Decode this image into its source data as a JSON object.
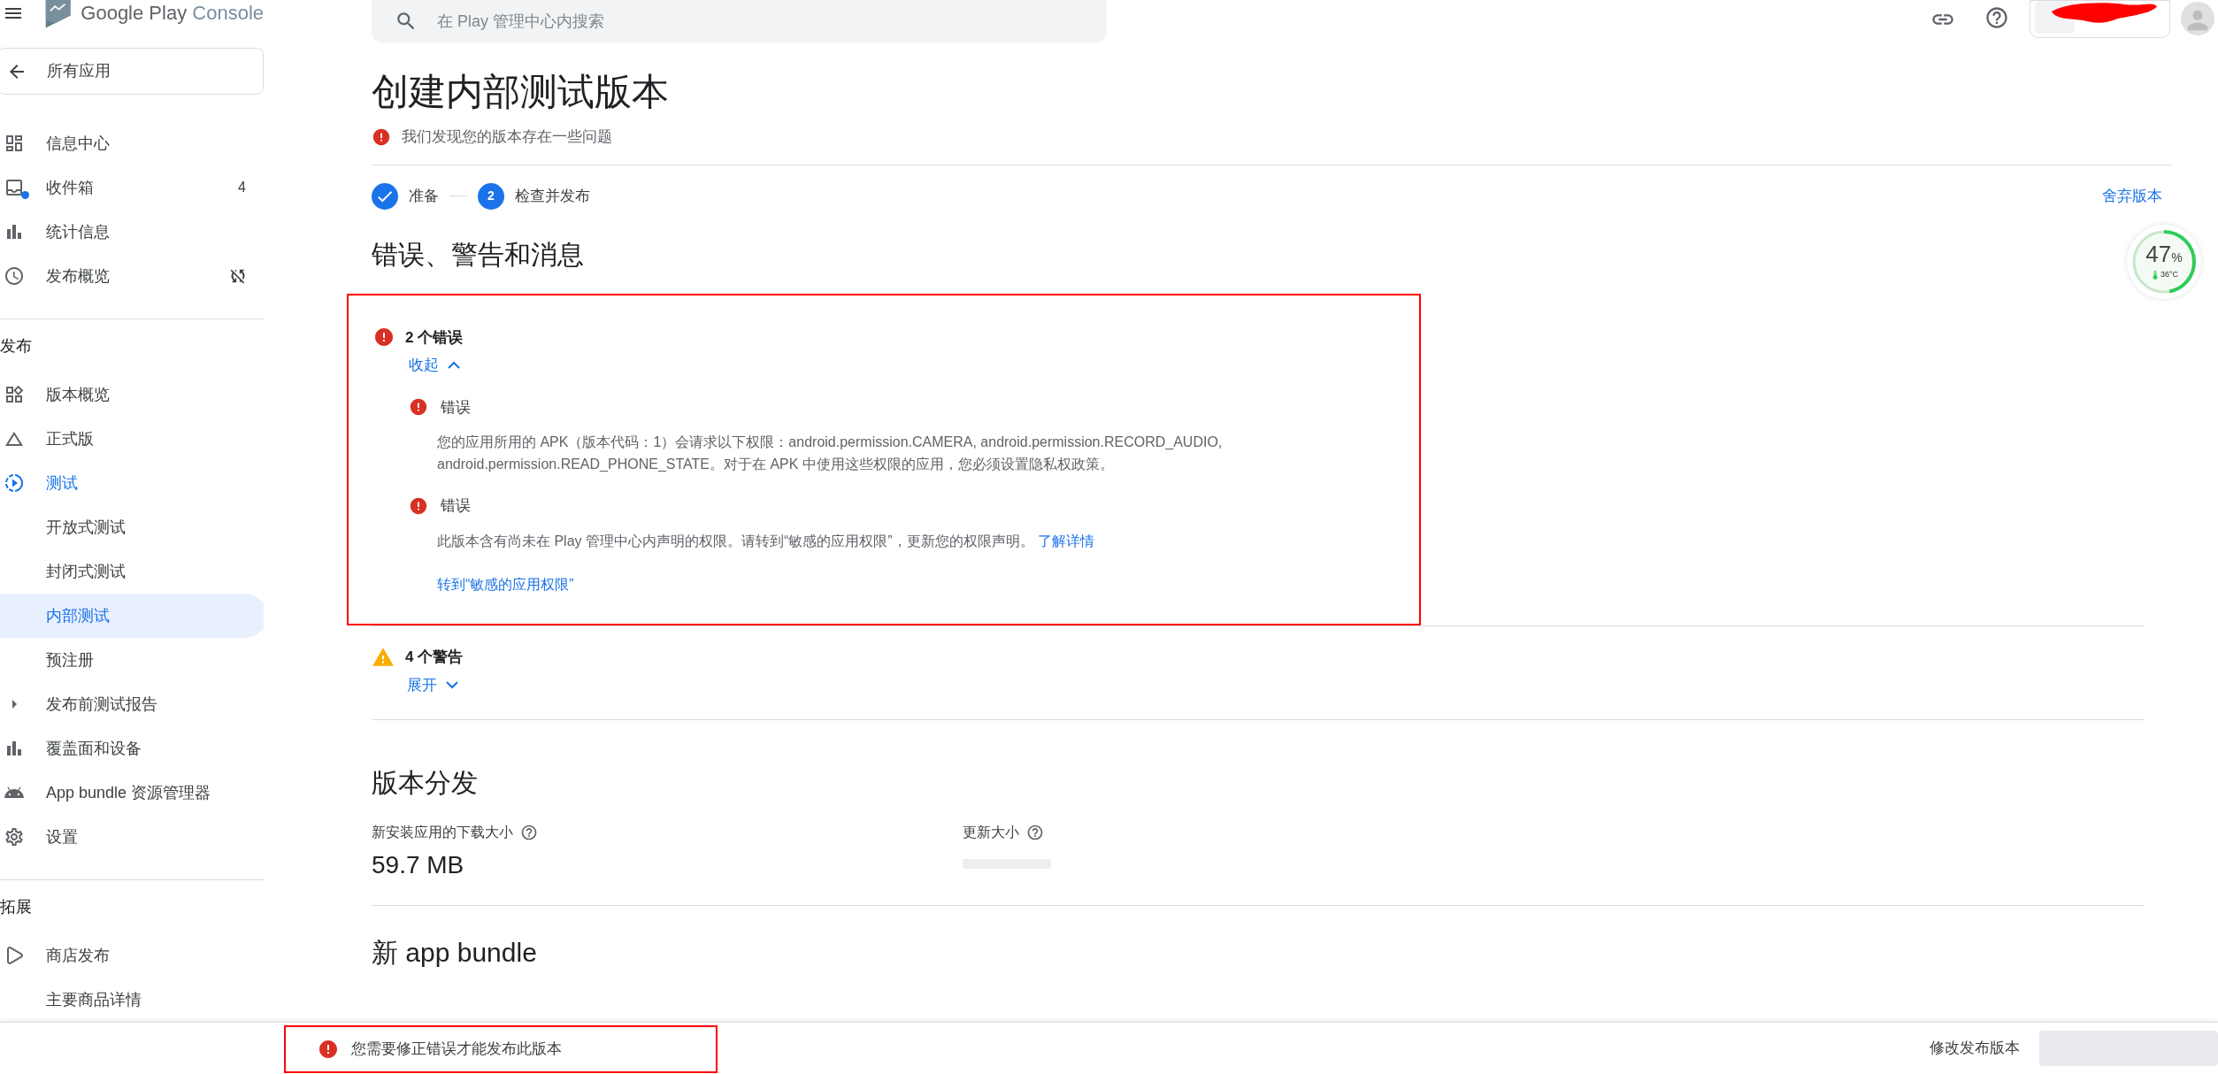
{
  "app_bar": {
    "brand": "Google Play",
    "product": "Console",
    "back": "所有应用"
  },
  "search": {
    "placeholder": "在 Play 管理中心内搜索"
  },
  "account": {
    "redacted": true
  },
  "sidebar": {
    "top_items": [
      {
        "label": "信息中心",
        "selected": false
      },
      {
        "label": "收件箱",
        "selected": false,
        "badge": "4",
        "unread": true
      },
      {
        "label": "统计信息",
        "selected": false
      },
      {
        "label": "发布概览",
        "selected": false,
        "managed_publishing": false
      }
    ],
    "sections": [
      {
        "title": "发布",
        "items": [
          {
            "label": "版本概览",
            "selected": false
          },
          {
            "label": "正式版",
            "selected": false
          },
          {
            "label": "测试",
            "selected": false,
            "children": [
              {
                "label": "开放式测试",
                "selected": false
              },
              {
                "label": "封闭式测试",
                "selected": false
              },
              {
                "label": "内部测试",
                "selected": true
              },
              {
                "label": "预注册",
                "selected": false
              }
            ]
          },
          {
            "label": "发布前测试报告",
            "selected": false,
            "expanded": false
          },
          {
            "label": "覆盖面和设备",
            "selected": false
          },
          {
            "label": "App bundle 资源管理器",
            "selected": false
          },
          {
            "label": "设置",
            "selected": false
          }
        ]
      },
      {
        "title": "拓展",
        "items": [
          {
            "label": "商店发布",
            "selected": false
          },
          {
            "label": "主要商品详情",
            "selected": false
          }
        ]
      }
    ]
  },
  "page": {
    "title": "创建内部测试版本",
    "status": "我们发现您的版本存在一些问题",
    "discard": "舍弃版本"
  },
  "stepper": [
    {
      "label": "准备",
      "done": true
    },
    {
      "label": "检查并发布",
      "done": false,
      "number": "2"
    }
  ],
  "issues": {
    "heading": "错误、警告和消息",
    "groups": [
      {
        "kind": "error",
        "summary": "2 个错误",
        "toggle": "收起",
        "expanded": true,
        "annotated": true,
        "items": [
          {
            "title": "错误",
            "text": "您的应用所用的 APK（版本代码：1）会请求以下权限：android.permission.CAMERA, android.permission.RECORD_AUDIO, android.permission.READ_PHONE_STATE。对于在 APK 中使用这些权限的应用，您必须设置隐私权政策。"
          },
          {
            "title": "错误",
            "text": "此版本含有尚未在 Play 管理中心内声明的权限。请转到“敏感的应用权限”，更新您的权限声明。",
            "link": "了解详情",
            "action": "转到“敏感的应用权限”"
          }
        ]
      },
      {
        "kind": "warning",
        "summary": "4 个警告",
        "toggle": "展开",
        "expanded": false,
        "annotated": false
      }
    ]
  },
  "distribution": {
    "heading": "版本分发",
    "metrics": [
      {
        "label": "新安装应用的下载大小",
        "value": "59.7 MB",
        "loading": false
      },
      {
        "label": "更新大小",
        "loading": true
      }
    ]
  },
  "bundle": {
    "heading": "新 app bundle"
  },
  "footer": {
    "message": "您需要修正错误才能发布此版本",
    "annotated": true,
    "secondary_button": "修改发布版本",
    "primary_disabled": true
  },
  "battery_widget": {
    "percent": "47",
    "unit": "%",
    "temperature": "36°C",
    "level": 0.47
  }
}
